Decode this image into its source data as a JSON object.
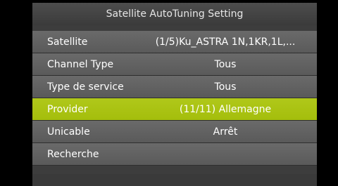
{
  "title": "Satellite AutoTuning Setting",
  "menu": {
    "items": [
      {
        "label": "Satellite",
        "value": "(1/5)Ku_ASTRA 1N,1KR,1L,..."
      },
      {
        "label": "Channel Type",
        "value": "Tous"
      },
      {
        "label": "Type de service",
        "value": "Tous"
      },
      {
        "label": "Provider",
        "value": "(11/11)  Allemagne"
      },
      {
        "label": "Unicable",
        "value": "Arrêt"
      },
      {
        "label": "Recherche",
        "value": ""
      }
    ],
    "selected_index": 3
  },
  "colors": {
    "highlight": "#a8c212",
    "row_bg": "#626262",
    "panel_bg": "#3d3d3d",
    "text": "#ffffff"
  }
}
